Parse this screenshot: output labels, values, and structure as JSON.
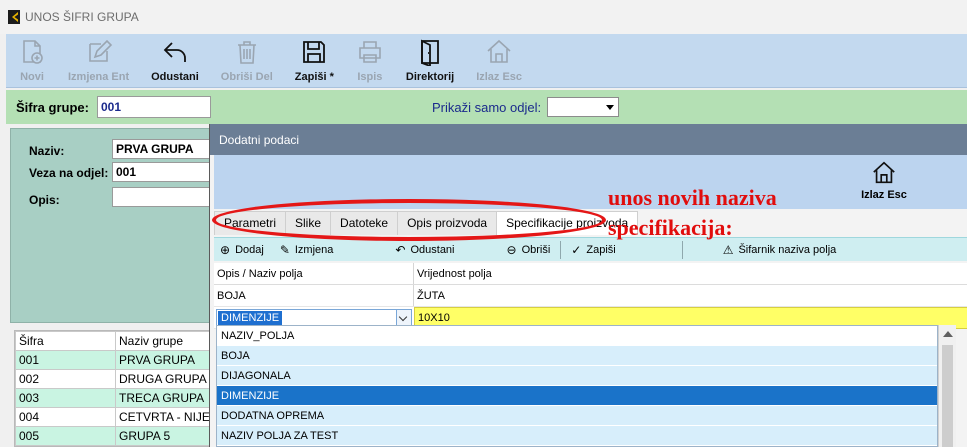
{
  "window": {
    "title": "UNOS ŠIFRI GRUPA"
  },
  "toolbar": {
    "items": [
      {
        "label": "Novi",
        "icon": "new-document-icon",
        "enabled": false
      },
      {
        "label": "Izmjena Ent",
        "icon": "edit-pencil-icon",
        "enabled": false
      },
      {
        "label": "Odustani",
        "icon": "undo-arrow-icon",
        "enabled": true
      },
      {
        "label": "Obriši Del",
        "icon": "trash-icon",
        "enabled": false
      },
      {
        "label": "Zapiši *",
        "icon": "save-floppy-icon",
        "enabled": true
      },
      {
        "label": "Ispis",
        "icon": "printer-icon",
        "enabled": false
      },
      {
        "label": "Direktorij",
        "icon": "directory-icon",
        "enabled": true
      },
      {
        "label": "Izlaz Esc",
        "icon": "home-icon",
        "enabled": false
      }
    ]
  },
  "group": {
    "label": "Šifra grupe:",
    "value": "001"
  },
  "odjel": {
    "label": "Prikaži samo odjel:",
    "value": ""
  },
  "form": {
    "naziv_label": "Naziv:",
    "naziv_value": "PRVA GRUPA",
    "veza_label": "Veza na odjel:",
    "veza_value": "001",
    "opis_label": "Opis:",
    "opis_value": ""
  },
  "grid": {
    "headers": [
      "Šifra",
      "Naziv grupe"
    ],
    "rows": [
      [
        "001",
        "PRVA GRUPA"
      ],
      [
        "002",
        "DRUGA GRUPA"
      ],
      [
        "003",
        "TRECA GRUPA"
      ],
      [
        "004",
        "CETVRTA - NIJE"
      ],
      [
        "005",
        "GRUPA 5"
      ]
    ]
  },
  "dialog": {
    "title": "Dodatni podaci",
    "exit_label": "Izlaz Esc",
    "tabs": [
      "Parametri",
      "Slike",
      "Datoteke",
      "Opis proizvoda",
      "Specifikacije proizvoda"
    ],
    "active_tab": 4,
    "actions": [
      {
        "label": "Dodaj",
        "icon": "plus-circle-icon"
      },
      {
        "label": "Izmjena",
        "icon": "edit-icon"
      },
      {
        "label": "Odustani",
        "icon": "undo-icon"
      },
      {
        "label": "Obriši",
        "icon": "minus-circle-icon"
      },
      {
        "label": "Zapiši",
        "icon": "check-circle-icon"
      },
      {
        "label": "Šifarnik naziva polja",
        "icon": "warning-triangle-icon"
      }
    ],
    "table": {
      "headers": [
        "Opis / Naziv polja",
        "Vrijednost polja"
      ],
      "rows": [
        [
          "BOJA",
          "ŽUTA"
        ]
      ],
      "edit_row": {
        "field": "DIMENZIJE",
        "value": "10X10"
      }
    },
    "dropdown": {
      "items": [
        "NAZIV_POLJA",
        "BOJA",
        "DIJAGONALA",
        "DIMENZIJE",
        "DODATNA OPREMA",
        "NAZIV POLJA ZA TEST"
      ],
      "selected": 3
    }
  },
  "annotation": {
    "text_line1": "unos novih naziva",
    "text_line2": "specifikacija:",
    "color": "#e10d0d"
  }
}
